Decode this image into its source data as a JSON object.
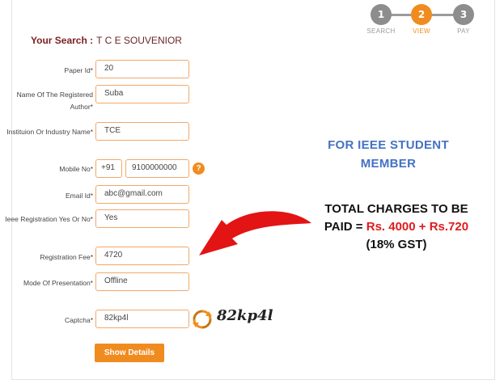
{
  "steps": [
    {
      "num": "1",
      "label": "SEARCH"
    },
    {
      "num": "2",
      "label": "VIEW"
    },
    {
      "num": "3",
      "label": "PAY"
    }
  ],
  "search": {
    "prefix": "Your Search :",
    "value": "T C E SOUVENIOR"
  },
  "form": {
    "paper_id": {
      "label": "Paper Id*",
      "value": "20"
    },
    "author": {
      "label": "Name Of The Registered Author*",
      "value": "Suba"
    },
    "institution": {
      "label": "Instituion Or Industry Name*",
      "value": "TCE"
    },
    "mobile": {
      "label": "Mobile No*",
      "code": "+91",
      "value": "9100000000",
      "help": "?"
    },
    "email": {
      "label": "Email Id*",
      "value": "abc@gmail.com"
    },
    "ieee": {
      "label": "Ieee Registration Yes Or No*",
      "value": "Yes"
    },
    "fee": {
      "label": "Registration Fee*",
      "value": "4720"
    },
    "mode": {
      "label": "Mode Of Presentation*",
      "value": "Offline"
    },
    "captcha": {
      "label": "Captcha*",
      "value": "82kp4l",
      "image_text": "82kp4l"
    },
    "submit": "Show Details"
  },
  "annotation": {
    "line1": "FOR IEEE STUDENT",
    "line2": "MEMBER",
    "charges_line1": "TOTAL CHARGES TO BE",
    "charges_paid": "PAID =",
    "charges_amount": "Rs. 4000 + Rs.720",
    "charges_gst": "(18% GST)"
  },
  "colors": {
    "accent": "#f08c1f",
    "annotation_blue": "#4472c4",
    "annotation_red": "#e01b1b"
  },
  "icons": [
    "refresh-icon",
    "help-icon",
    "arrow-icon"
  ]
}
